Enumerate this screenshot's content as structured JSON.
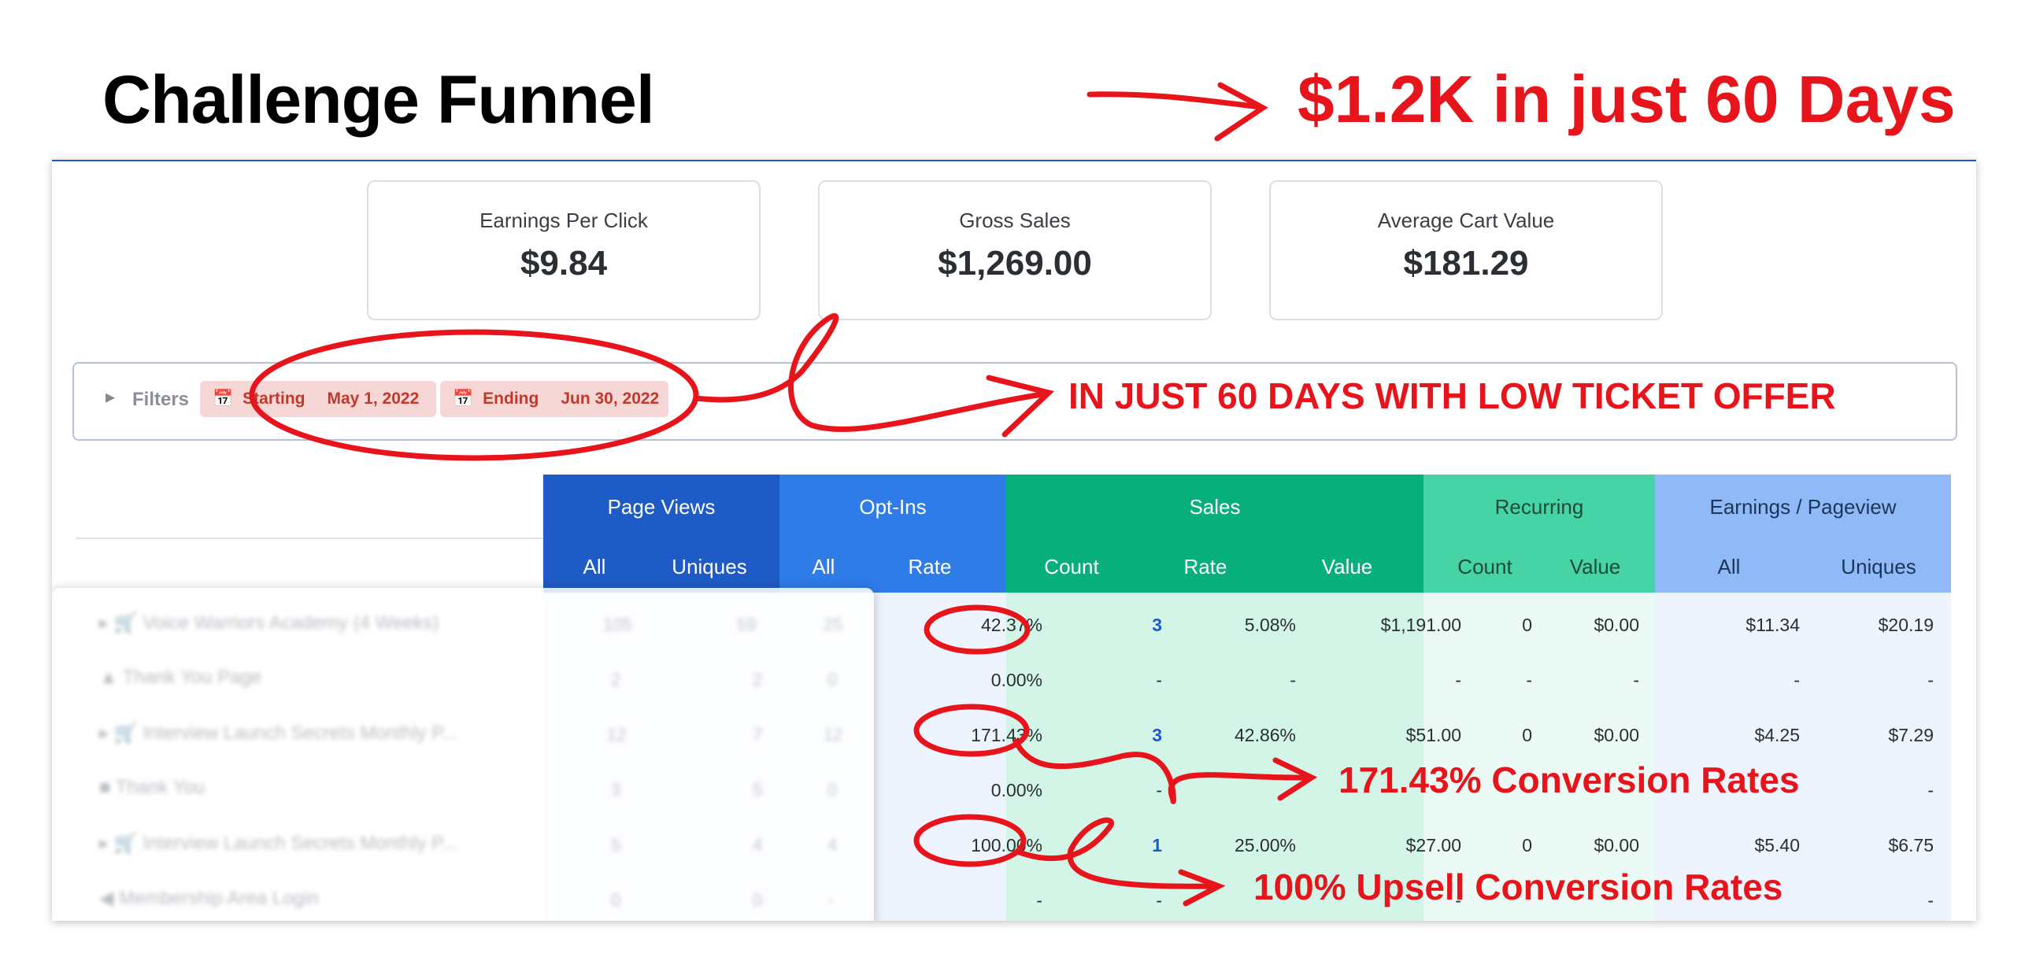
{
  "header": {
    "title": "Challenge Funnel",
    "headline": "$1.2K in just 60 Days"
  },
  "stats": [
    {
      "label": "Earnings Per Click",
      "value": "$9.84"
    },
    {
      "label": "Gross Sales",
      "value": "$1,269.00"
    },
    {
      "label": "Average Cart Value",
      "value": "$181.29"
    }
  ],
  "filters": {
    "label": "Filters",
    "starting_label": "Starting",
    "starting_date": "May 1, 2022",
    "ending_label": "Ending",
    "ending_date": "Jun 30, 2022"
  },
  "table": {
    "groups": [
      "Page Views",
      "Opt-Ins",
      "Sales",
      "Recurring",
      "Earnings / Pageview"
    ],
    "subheaders": [
      "All",
      "Uniques",
      "All",
      "Rate",
      "Count",
      "Rate",
      "Value",
      "Count",
      "Value",
      "All",
      "Uniques"
    ],
    "rows": [
      {
        "name": "Voice Warriors Academy (4 Weeks)",
        "pv_all": "105",
        "pv_uniques": "59",
        "opt_all": "25",
        "opt_rate": "42.37%",
        "sales_count": "3",
        "sales_rate": "5.08%",
        "sales_value": "$1,191.00",
        "rec_count": "0",
        "rec_value": "$0.00",
        "epv_all": "$11.34",
        "epv_uniques": "$20.19"
      },
      {
        "name": "Thank You Page",
        "pv_all": "2",
        "pv_uniques": "2",
        "opt_all": "0",
        "opt_rate": "0.00%",
        "sales_count": "-",
        "sales_rate": "-",
        "sales_value": "-",
        "rec_count": "-",
        "rec_value": "-",
        "epv_all": "-",
        "epv_uniques": "-"
      },
      {
        "name": "Interview Launch Secrets Monthly P...",
        "pv_all": "12",
        "pv_uniques": "7",
        "opt_all": "12",
        "opt_rate": "171.43%",
        "sales_count": "3",
        "sales_rate": "42.86%",
        "sales_value": "$51.00",
        "rec_count": "0",
        "rec_value": "$0.00",
        "epv_all": "$4.25",
        "epv_uniques": "$7.29"
      },
      {
        "name": "Thank You",
        "pv_all": "3",
        "pv_uniques": "5",
        "opt_all": "0",
        "opt_rate": "0.00%",
        "sales_count": "-",
        "sales_rate": "",
        "sales_value": "",
        "rec_count": "",
        "rec_value": "",
        "epv_all": "",
        "epv_uniques": "-"
      },
      {
        "name": "Interview Launch Secrets Monthly P...",
        "pv_all": "5",
        "pv_uniques": "4",
        "opt_all": "4",
        "opt_rate": "100.00%",
        "sales_count": "1",
        "sales_rate": "25.00%",
        "sales_value": "$27.00",
        "rec_count": "0",
        "rec_value": "$0.00",
        "epv_all": "$5.40",
        "epv_uniques": "$6.75"
      },
      {
        "name": "Membership Area Login",
        "pv_all": "0",
        "pv_uniques": "0",
        "opt_all": "-",
        "opt_rate": "-",
        "sales_count": "-",
        "sales_rate": "",
        "sales_value": "-",
        "rec_count": "",
        "rec_value": "",
        "epv_all": "",
        "epv_uniques": "-"
      }
    ]
  },
  "annotations": {
    "days": "IN JUST 60 DAYS WITH LOW TICKET OFFER",
    "conversion": "171.43% Conversion Rates",
    "upsell": "100% Upsell Conversion Rates"
  },
  "colors": {
    "accent_red": "#e8141b",
    "page_views": "#1f5bc6",
    "opt_ins": "#2f7be8",
    "sales": "#07b07a",
    "recurring": "#46d3a5",
    "earnings": "#8fbaf7"
  }
}
